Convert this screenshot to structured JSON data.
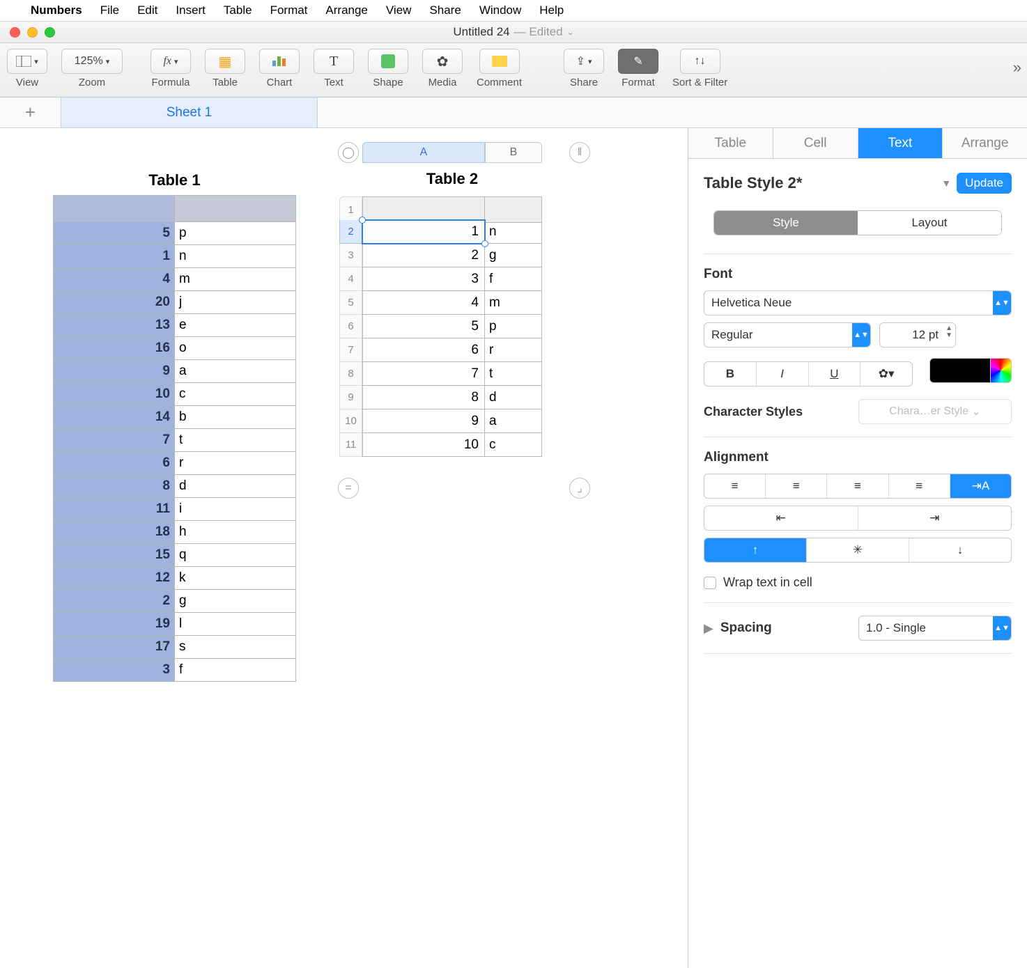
{
  "menubar": {
    "app": "Numbers",
    "items": [
      "File",
      "Edit",
      "Insert",
      "Table",
      "Format",
      "Arrange",
      "View",
      "Share",
      "Window",
      "Help"
    ]
  },
  "titlebar": {
    "title": "Untitled 24",
    "status": "— Edited"
  },
  "toolbar": {
    "view": "View",
    "zoom_label": "Zoom",
    "zoom_value": "125%",
    "formula": "Formula",
    "table": "Table",
    "chart": "Chart",
    "text": "Text",
    "shape": "Shape",
    "media": "Media",
    "comment": "Comment",
    "share": "Share",
    "format": "Format",
    "sortfilter": "Sort & Filter"
  },
  "sheets": {
    "active": "Sheet 1"
  },
  "inspector": {
    "tabs": {
      "table": "Table",
      "cell": "Cell",
      "text": "Text",
      "arrange": "Arrange"
    },
    "style_title": "Table Style 2*",
    "update": "Update",
    "seg_style": "Style",
    "seg_layout": "Layout",
    "font_label": "Font",
    "font_name": "Helvetica Neue",
    "font_weight": "Regular",
    "font_size": "12 pt",
    "char_styles_label": "Character Styles",
    "char_styles_value": "Chara…er Style",
    "alignment_label": "Alignment",
    "wrap_label": "Wrap text in cell",
    "spacing_label": "Spacing",
    "spacing_value": "1.0 - Single"
  },
  "table1": {
    "title": "Table 1",
    "rows": [
      {
        "a": "5",
        "b": "p"
      },
      {
        "a": "1",
        "b": "n"
      },
      {
        "a": "4",
        "b": "m"
      },
      {
        "a": "20",
        "b": "j"
      },
      {
        "a": "13",
        "b": "e"
      },
      {
        "a": "16",
        "b": "o"
      },
      {
        "a": "9",
        "b": "a"
      },
      {
        "a": "10",
        "b": "c"
      },
      {
        "a": "14",
        "b": "b"
      },
      {
        "a": "7",
        "b": "t"
      },
      {
        "a": "6",
        "b": "r"
      },
      {
        "a": "8",
        "b": "d"
      },
      {
        "a": "11",
        "b": "i"
      },
      {
        "a": "18",
        "b": "h"
      },
      {
        "a": "15",
        "b": "q"
      },
      {
        "a": "12",
        "b": "k"
      },
      {
        "a": "2",
        "b": "g"
      },
      {
        "a": "19",
        "b": "l"
      },
      {
        "a": "17",
        "b": "s"
      },
      {
        "a": "3",
        "b": "f"
      }
    ]
  },
  "table2": {
    "title": "Table 2",
    "col_labels": {
      "A": "A",
      "B": "B"
    },
    "rows": [
      {
        "n": "1",
        "a": "",
        "b": ""
      },
      {
        "n": "2",
        "a": "1",
        "b": "n"
      },
      {
        "n": "3",
        "a": "2",
        "b": "g"
      },
      {
        "n": "4",
        "a": "3",
        "b": "f"
      },
      {
        "n": "5",
        "a": "4",
        "b": "m"
      },
      {
        "n": "6",
        "a": "5",
        "b": "p"
      },
      {
        "n": "7",
        "a": "6",
        "b": "r"
      },
      {
        "n": "8",
        "a": "7",
        "b": "t"
      },
      {
        "n": "9",
        "a": "8",
        "b": "d"
      },
      {
        "n": "10",
        "a": "9",
        "b": "a"
      },
      {
        "n": "11",
        "a": "10",
        "b": "c"
      }
    ]
  }
}
